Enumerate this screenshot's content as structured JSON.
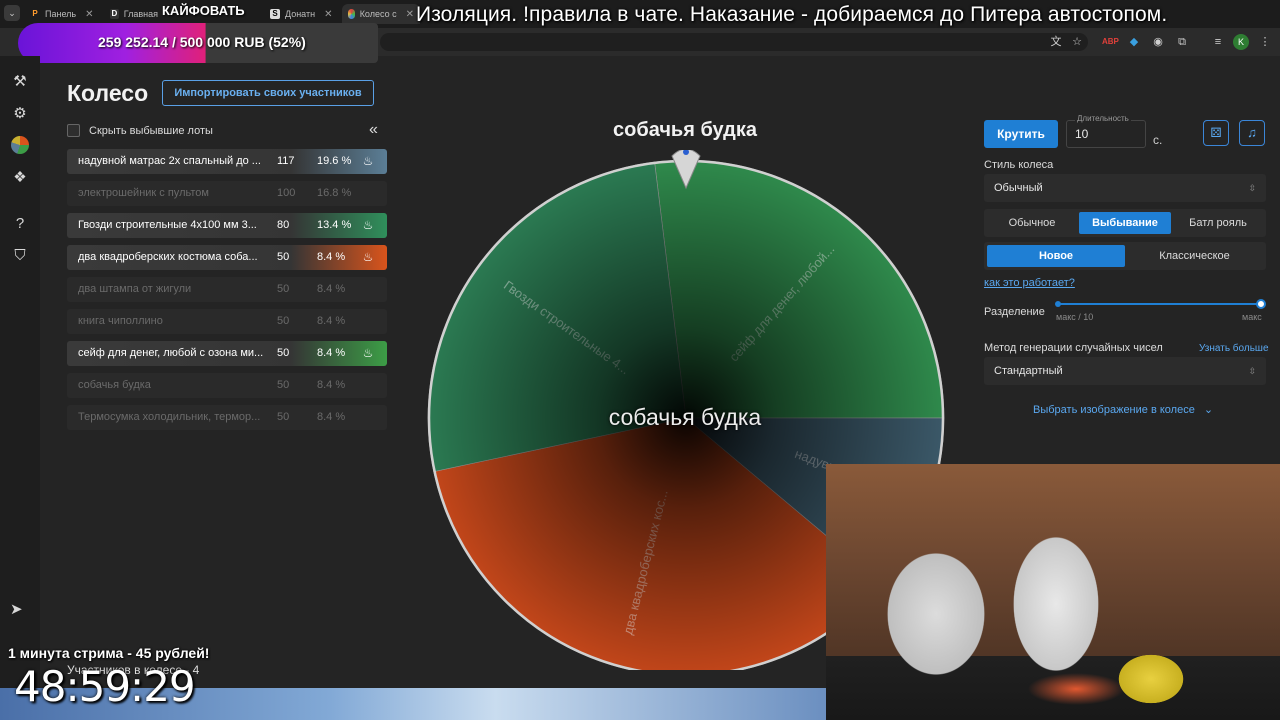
{
  "browser": {
    "tabs": [
      {
        "label": "Панель",
        "icon": "orange-p-favicon"
      },
      {
        "label": "Главная",
        "icon": "d-favicon"
      },
      {
        "label": "",
        "icon": "blank-favicon"
      },
      {
        "label": "Донатн",
        "icon": "s-favicon"
      },
      {
        "label": "Колесо с",
        "icon": "wheel-favicon",
        "active": true
      }
    ]
  },
  "stream": {
    "top_title": "Изоляция. !правила в чате. Наказание - добираемся до Питера автостопом.",
    "kaif": "КАЙФОВАТЬ",
    "donation": "259 252.14 / 500 000 RUB (52%)",
    "donation_progress": 0.52,
    "promo": "1 минута стрима - 45 рублей!",
    "timer": "48:59:29"
  },
  "page": {
    "title": "Колесо",
    "import_button": "Импортировать своих участников",
    "hide_label": "Скрыть выбывшие лоты",
    "participants": "Участников в колесе - 4"
  },
  "lots": [
    {
      "name": "надувной матрас 2х спальный до ...",
      "amount": "117",
      "percent": "19.6 %",
      "state": "active",
      "color": "#5b7e96"
    },
    {
      "name": "электрошейник с пультом",
      "amount": "100",
      "percent": "16.8 %",
      "state": "out"
    },
    {
      "name": "Гвозди строительные 4х100 мм 3...",
      "amount": "80",
      "percent": "13.4 %",
      "state": "active",
      "color": "#2f8f5b"
    },
    {
      "name": "два квадроберских костюма соба...",
      "amount": "50",
      "percent": "8.4 %",
      "state": "active",
      "color": "#d9541c"
    },
    {
      "name": "два штампа от жигули",
      "amount": "50",
      "percent": "8.4 %",
      "state": "out"
    },
    {
      "name": "книга чиполлино",
      "amount": "50",
      "percent": "8.4 %",
      "state": "out"
    },
    {
      "name": "сейф для денег, любой с озона ми...",
      "amount": "50",
      "percent": "8.4 %",
      "state": "active",
      "color": "#3c9d46"
    },
    {
      "name": "собачья будка",
      "amount": "50",
      "percent": "8.4 %",
      "state": "out"
    },
    {
      "name": "Термосумка холодильник, термор...",
      "amount": "50",
      "percent": "8.4 %",
      "state": "out"
    }
  ],
  "wheel": {
    "winner_top": "собачья будка",
    "center_label": "собачья будка",
    "segments": [
      {
        "label": "сейф для денег, любой...",
        "color": "#2f8a4c"
      },
      {
        "label": "надувной м",
        "color": "#3b5868"
      },
      {
        "label": "два квадроберских кос...",
        "color": "#c2461a"
      },
      {
        "label": "Гвозди строительные 4...",
        "color": "#2b7a52"
      }
    ]
  },
  "controls": {
    "spin": "Крутить",
    "duration_legend": "Длительность",
    "duration_value": "10",
    "duration_unit": "с.",
    "dice_icon": "dice-icon",
    "music_icon": "music-icon",
    "style_label": "Стиль колеса",
    "style_value": "Обычный",
    "modes": [
      "Обычное",
      "Выбывание",
      "Батл рояль"
    ],
    "mode_selected": "Выбывание",
    "variants": [
      "Новое",
      "Классическое"
    ],
    "variant_selected": "Новое",
    "how_link": "как это работает?",
    "split_label": "Разделение",
    "split_min": "макс / 10",
    "split_max": "макс",
    "split_value": 1.0,
    "rng_label": "Метод генерации случайных чисел",
    "rng_more": "Узнать больше",
    "rng_value": "Стандартный",
    "choose_image": "Выбрать изображение в колесе"
  }
}
